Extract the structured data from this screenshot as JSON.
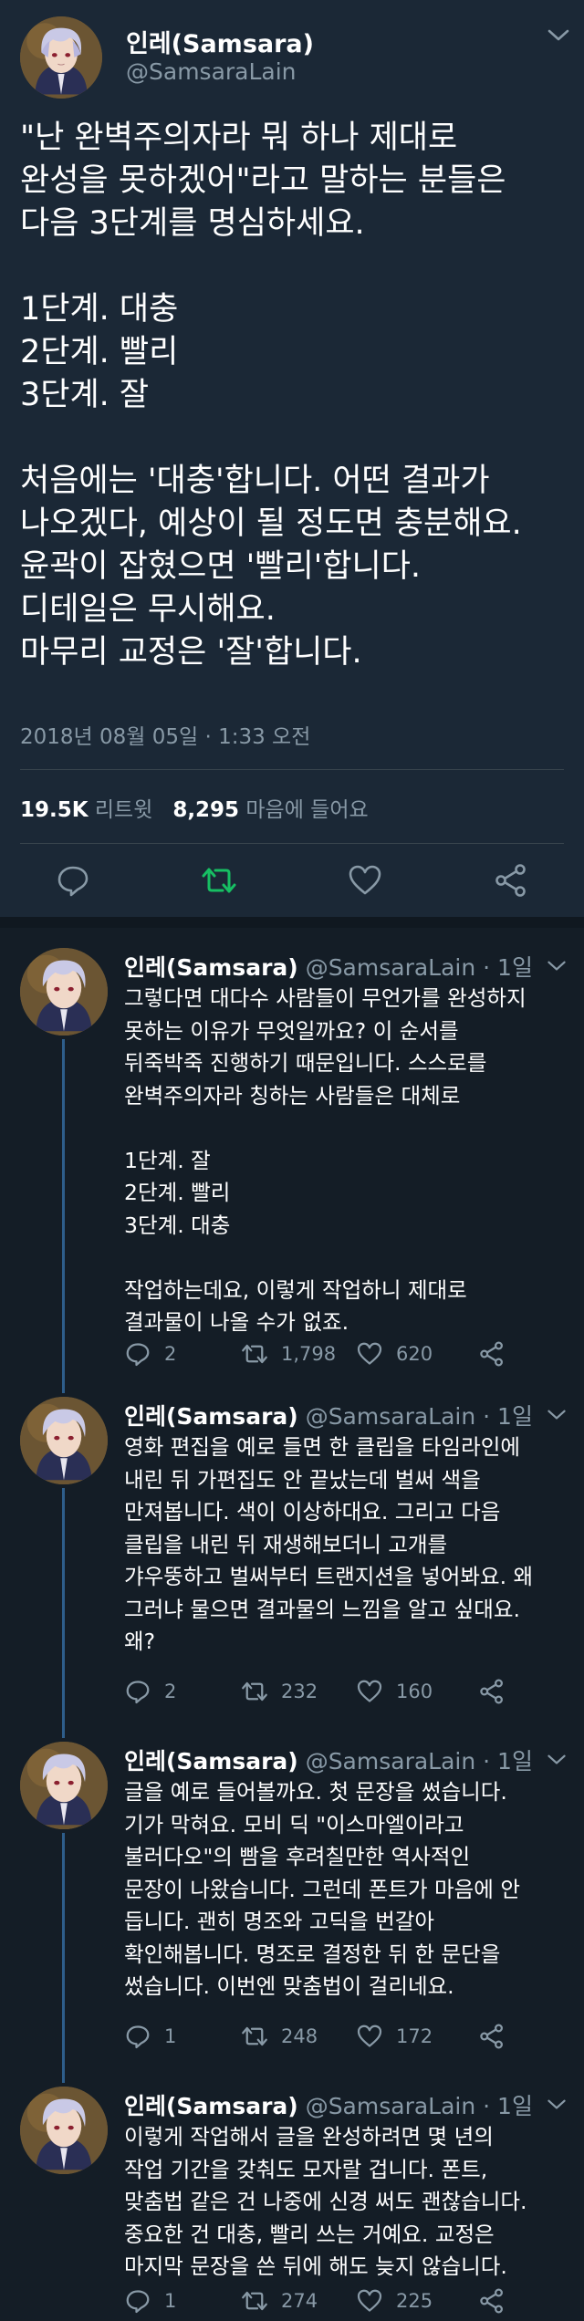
{
  "main_tweet": {
    "name": "인레(Samsara)",
    "handle": "@SamsaraLain",
    "lines": [
      "\"난 완벽주의자라 뭐 하나 제대로",
      "완성을 못하겠어\"라고 말하는 분들은",
      "다음 3단계를 명심하세요.",
      "",
      "1단계. 대충",
      "2단계. 빨리",
      "3단계. 잘",
      "",
      "처음에는 '대충'합니다. 어떤 결과가",
      "나오겠다, 예상이 될 정도면 충분해요.",
      "윤곽이 잡혔으면 '빨리'합니다.",
      "디테일은 무시해요.",
      "마무리 교정은 '잘'합니다."
    ],
    "timestamp": "2018년 08월 05일 · 1:33 오전",
    "retweets_count": "19.5K",
    "retweets_label": "리트윗",
    "likes_count": "8,295",
    "likes_label": "마음에 들어요",
    "action_icons": [
      "reply-icon",
      "retweet-icon",
      "like-icon",
      "share-icon"
    ],
    "retweet_active_color": "#17bf63"
  },
  "replies": [
    {
      "name": "인레(Samsara)",
      "handle": "@SamsaraLain · 1일",
      "lines": [
        "그렇다면 대다수 사람들이 무언가를 완성하지",
        "못하는 이유가 무엇일까요? 이 순서를",
        "뒤죽박죽 진행하기 때문입니다. 스스로를",
        "완벽주의자라 칭하는 사람들은 대체로",
        "",
        "1단계. 잘",
        "2단계. 빨리",
        "3단계. 대충",
        "",
        "작업하는데요, 이렇게 작업하니 제대로",
        "결과물이 나올 수가 없죠."
      ],
      "replies_count": "2",
      "retweets_count": "1,798",
      "likes_count": "620"
    },
    {
      "name": "인레(Samsara)",
      "handle": "@SamsaraLain · 1일",
      "lines": [
        "영화 편집을 예로 들면 한 클립을 타임라인에",
        "내린 뒤 가편집도 안 끝났는데 벌써 색을",
        "만져봅니다. 색이 이상하대요. 그리고 다음",
        "클립을 내린 뒤 재생해보더니 고개를",
        "갸우뚱하고 벌써부터 트랜지션을 넣어봐요. 왜",
        "그러냐 물으면 결과물의 느낌을 알고 싶대요.",
        "왜?"
      ],
      "replies_count": "2",
      "retweets_count": "232",
      "likes_count": "160"
    },
    {
      "name": "인레(Samsara)",
      "handle": "@SamsaraLain · 1일",
      "lines": [
        "글을 예로 들어볼까요. 첫 문장을 썼습니다.",
        "기가 막혀요. 모비 딕 \"이스마엘이라고",
        "불러다오\"의 빰을 후려칠만한 역사적인",
        "문장이 나왔습니다. 그런데 폰트가 마음에 안",
        "듭니다. 괜히 명조와 고딕을 번갈아",
        "확인해봅니다. 명조로 결정한 뒤 한 문단을",
        "썼습니다. 이번엔 맞춤법이 걸리네요."
      ],
      "replies_count": "1",
      "retweets_count": "248",
      "likes_count": "172"
    },
    {
      "name": "인레(Samsara)",
      "handle": "@SamsaraLain · 1일",
      "lines": [
        "이렇게 작업해서 글을 완성하려면 몇 년의",
        "작업 기간을 갖춰도 모자랄 겁니다. 폰트,",
        "맞춤법 같은 건 나중에 신경 써도 괜찮습니다.",
        "중요한 건 대충, 빨리 쓰는 거예요. 교정은",
        "마지막 문장을 쓴 뒤에 해도 늦지 않습니다."
      ],
      "replies_count": "1",
      "retweets_count": "274",
      "likes_count": "225"
    }
  ]
}
